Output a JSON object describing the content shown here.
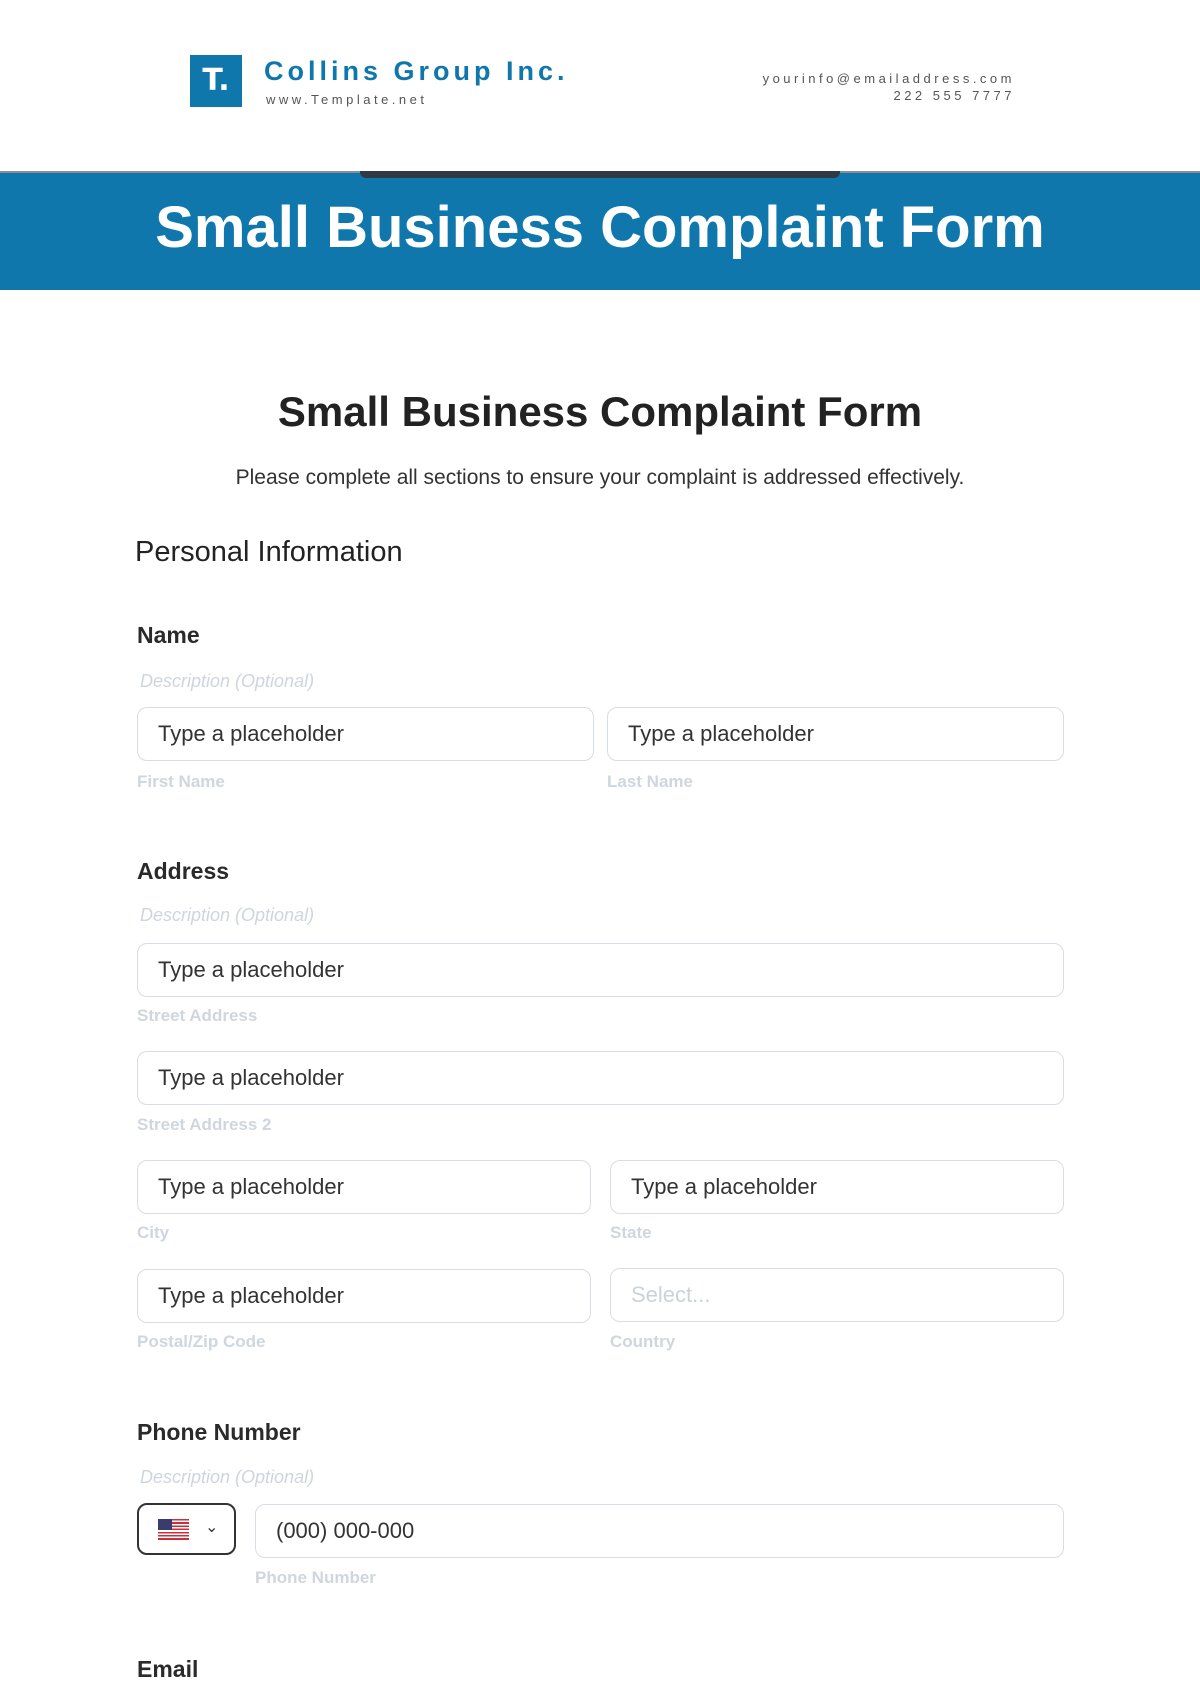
{
  "header": {
    "logo_letter": "T.",
    "company": "Collins Group Inc.",
    "website": "www.Template.net",
    "email": "yourinfo@emailaddress.com",
    "phone": "222 555 7777"
  },
  "banner": {
    "title": "Small Business Complaint Form"
  },
  "form": {
    "title": "Small Business Complaint Form",
    "subtitle": "Please complete all sections to ensure your complaint is addressed effectively.",
    "section": "Personal Information",
    "name": {
      "label": "Name",
      "description": "Description (Optional)",
      "first": {
        "placeholder": "Type a placeholder",
        "sublabel": "First Name"
      },
      "last": {
        "placeholder": "Type a placeholder",
        "sublabel": "Last Name"
      }
    },
    "address": {
      "label": "Address",
      "description": "Description (Optional)",
      "street": {
        "placeholder": "Type a placeholder",
        "sublabel": "Street Address"
      },
      "street2": {
        "placeholder": "Type a placeholder",
        "sublabel": "Street Address 2"
      },
      "city": {
        "placeholder": "Type a placeholder",
        "sublabel": "City"
      },
      "state": {
        "placeholder": "Type a placeholder",
        "sublabel": "State"
      },
      "zip": {
        "placeholder": "Type a placeholder",
        "sublabel": "Postal/Zip Code"
      },
      "country": {
        "placeholder": "Select...",
        "sublabel": "Country"
      }
    },
    "phone": {
      "label": "Phone Number",
      "description": "Description (Optional)",
      "country_flag": "us-flag-icon",
      "value": "(000) 000-000",
      "sublabel": "Phone Number"
    },
    "email": {
      "label": "Email"
    }
  },
  "colors": {
    "brand": "#1077ad"
  }
}
